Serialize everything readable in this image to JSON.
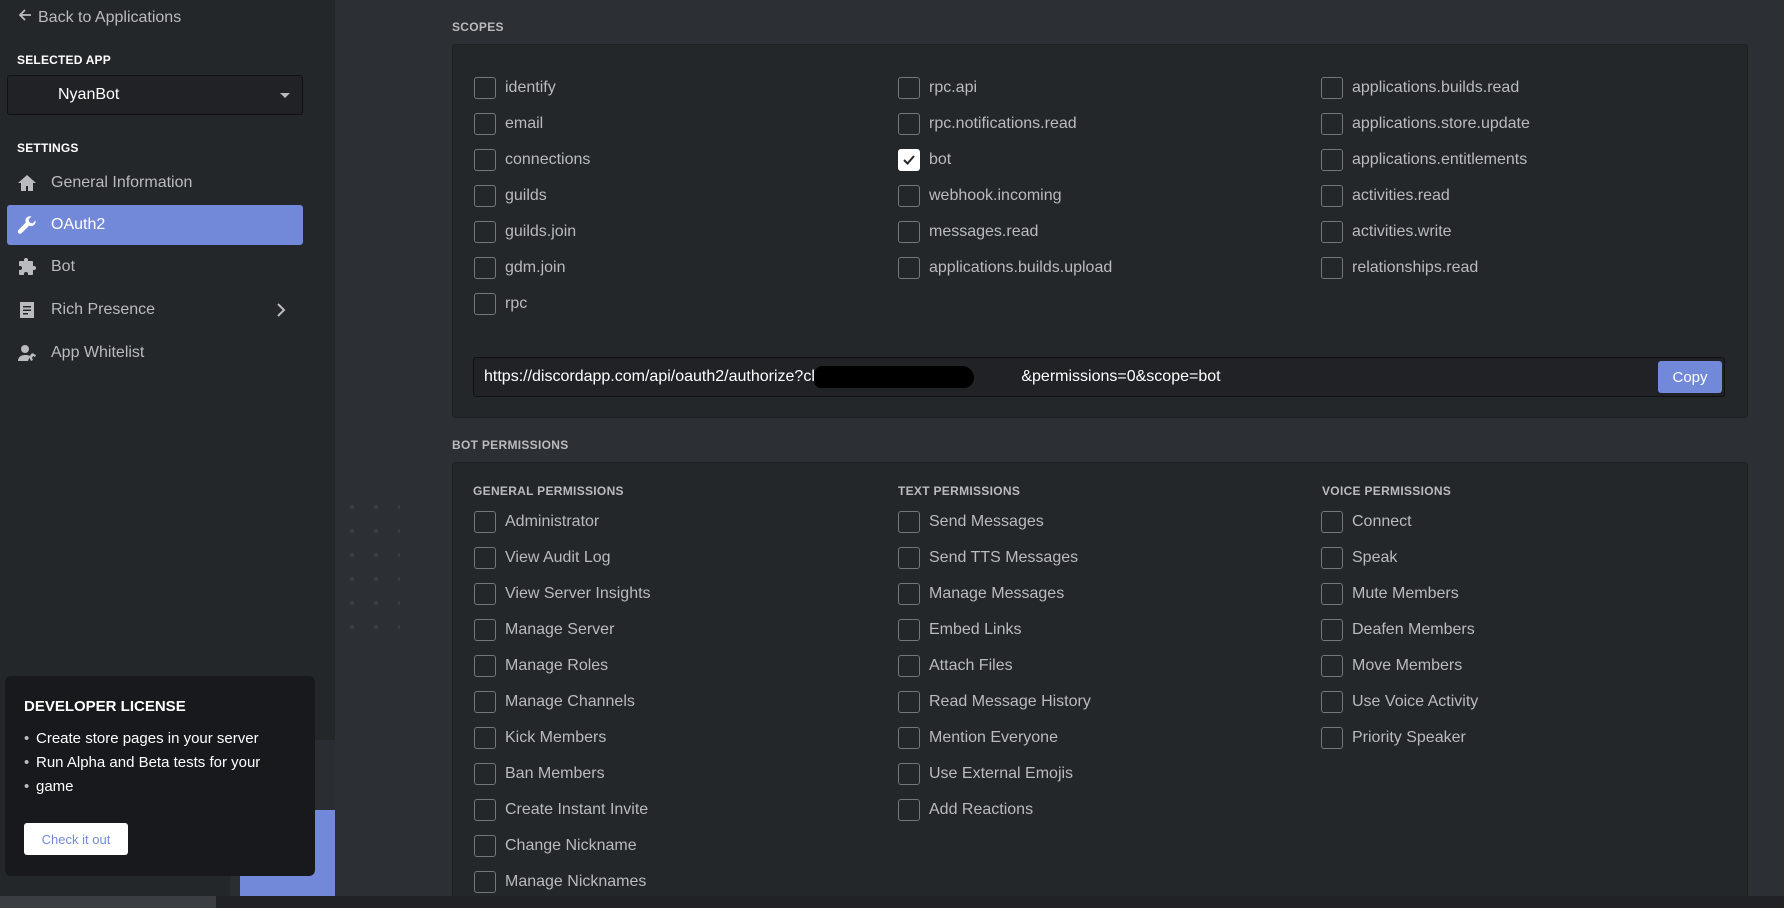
{
  "sidebar": {
    "back_label": "Back to Applications",
    "selected_app_heading": "SELECTED APP",
    "selected_app": "NyanBot",
    "settings_heading": "SETTINGS",
    "items": [
      {
        "label": "General Information",
        "icon": "home-icon"
      },
      {
        "label": "OAuth2",
        "icon": "wrench-icon",
        "active": true
      },
      {
        "label": "Bot",
        "icon": "puzzle-icon"
      },
      {
        "label": "Rich Presence",
        "icon": "document-icon"
      },
      {
        "label": "App Whitelist",
        "icon": "user-phone-icon"
      }
    ],
    "dev_card": {
      "title": "DEVELOPER LICENSE",
      "bullets": [
        "Create store pages in your server",
        "Run Alpha and Beta tests for your",
        "game"
      ],
      "button": "Check it out"
    }
  },
  "scopes": {
    "title": "SCOPES",
    "col1": [
      "identify",
      "email",
      "connections",
      "guilds",
      "guilds.join",
      "gdm.join",
      "rpc"
    ],
    "col2": [
      "rpc.api",
      "rpc.notifications.read",
      "bot",
      "webhook.incoming",
      "messages.read",
      "applications.builds.upload"
    ],
    "col3": [
      "applications.builds.read",
      "applications.store.update",
      "applications.entitlements",
      "activities.read",
      "activities.write",
      "relationships.read"
    ],
    "checked": "bot",
    "url_start": "https://discordapp.com/api/oauth2/authorize?client_id=",
    "url_end": "&permissions=0&scope=bot",
    "copy_label": "Copy"
  },
  "bot_permissions": {
    "title": "BOT PERMISSIONS",
    "general_heading": "GENERAL PERMISSIONS",
    "general": [
      "Administrator",
      "View Audit Log",
      "View Server Insights",
      "Manage Server",
      "Manage Roles",
      "Manage Channels",
      "Kick Members",
      "Ban Members",
      "Create Instant Invite",
      "Change Nickname",
      "Manage Nicknames"
    ],
    "text_heading": "TEXT PERMISSIONS",
    "text": [
      "Send Messages",
      "Send TTS Messages",
      "Manage Messages",
      "Embed Links",
      "Attach Files",
      "Read Message History",
      "Mention Everyone",
      "Use External Emojis",
      "Add Reactions"
    ],
    "voice_heading": "VOICE PERMISSIONS",
    "voice": [
      "Connect",
      "Speak",
      "Mute Members",
      "Deafen Members",
      "Move Members",
      "Use Voice Activity",
      "Priority Speaker"
    ]
  },
  "colors": {
    "accent": "#7289da",
    "sidebar_bg": "#23272a",
    "page_bg": "#2c2f33"
  }
}
